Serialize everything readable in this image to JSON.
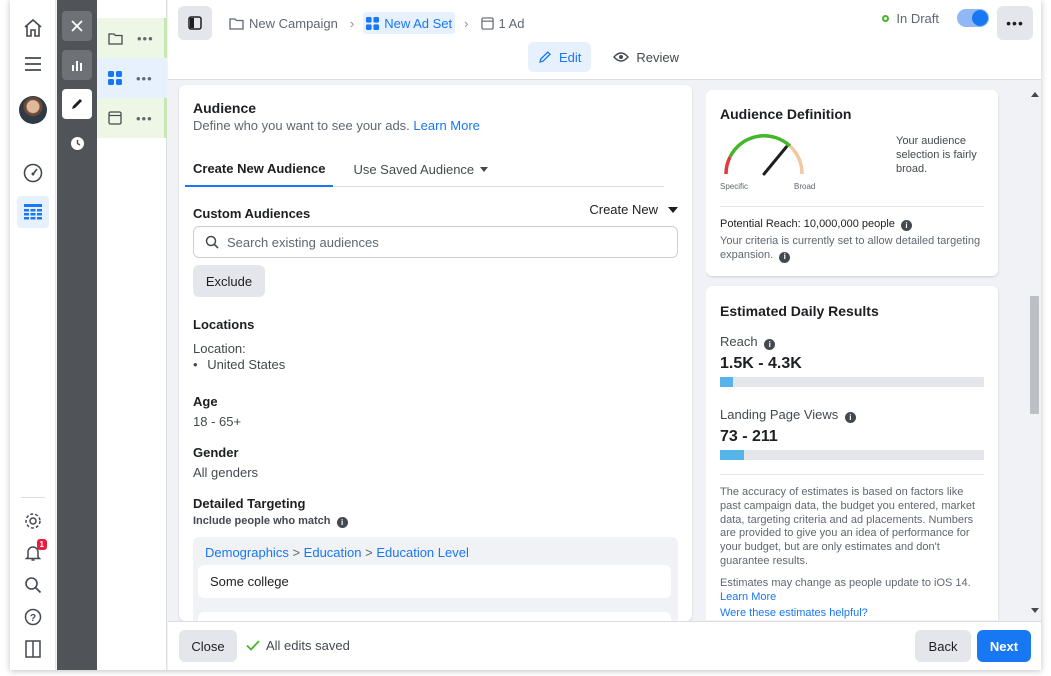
{
  "rail": {
    "items": [
      "home-icon",
      "menu-icon",
      "avatar",
      "gauge-icon",
      "table-icon",
      "settings-icon",
      "bell-icon",
      "search-icon",
      "help-icon",
      "sidebar-icon"
    ],
    "notification_count": "1"
  },
  "tools": [
    "close-icon",
    "bar-chart-icon",
    "pencil-icon",
    "clock-icon"
  ],
  "structure": {
    "rows": [
      {
        "icon": "folder-icon",
        "more": "•••"
      },
      {
        "icon": "grid-icon",
        "more": "•••"
      },
      {
        "icon": "ad-icon",
        "more": "•••"
      }
    ]
  },
  "topbar": {
    "breadcrumbs": [
      "New Campaign",
      "New Ad Set",
      "1 Ad"
    ],
    "status": "In Draft",
    "more": "•••",
    "edit": "Edit",
    "review": "Review"
  },
  "audience": {
    "title": "Audience",
    "subtitle": "Define who you want to see your ads.",
    "learn_more": "Learn More",
    "tabs": [
      "Create New Audience",
      "Use Saved Audience"
    ],
    "custom_audiences_label": "Custom Audiences",
    "create_new": "Create New",
    "search_placeholder": "Search existing audiences",
    "exclude": "Exclude",
    "locations_label": "Locations",
    "location_prefix": "Location:",
    "location_bullet": "•",
    "location_value": "United States",
    "age_label": "Age",
    "age_value": "18 - 65+",
    "gender_label": "Gender",
    "gender_value": "All genders",
    "detailed_label": "Detailed Targeting",
    "include_label": "Include people who match",
    "targeting_path": [
      "Demographics",
      "Education",
      "Education Level"
    ],
    "targeting_sep": ">",
    "targeting_item": "Some college"
  },
  "definition": {
    "title": "Audience Definition",
    "gauge_specific": "Specific",
    "gauge_broad": "Broad",
    "gauge_level": 0.72,
    "description": "Your audience selection is fairly broad.",
    "potential_reach": "Potential Reach: 10,000,000 people",
    "note": "Your criteria is currently set to allow detailed targeting expansion."
  },
  "results": {
    "title": "Estimated Daily Results",
    "reach_label": "Reach",
    "reach_value": "1.5K - 4.3K",
    "reach_fill": 0.05,
    "lpv_label": "Landing Page Views",
    "lpv_value": "73 - 211",
    "lpv_fill": 0.09,
    "disclaimer": "The accuracy of estimates is based on factors like past campaign data, the budget you entered, market data, targeting criteria and ad placements. Numbers are provided to give you an idea of performance for your budget, but are only estimates and don't guarantee results.",
    "ios_note": "Estimates may change as people update to iOS 14.",
    "learn_more": "Learn More",
    "helpful": "Were these estimates helpful?"
  },
  "footer": {
    "close": "Close",
    "saved": "All edits saved",
    "back": "Back",
    "next": "Next"
  },
  "colors": {
    "accent": "#1877f2",
    "bar_fill": "#56b4e9",
    "draft": "#42b72a"
  }
}
